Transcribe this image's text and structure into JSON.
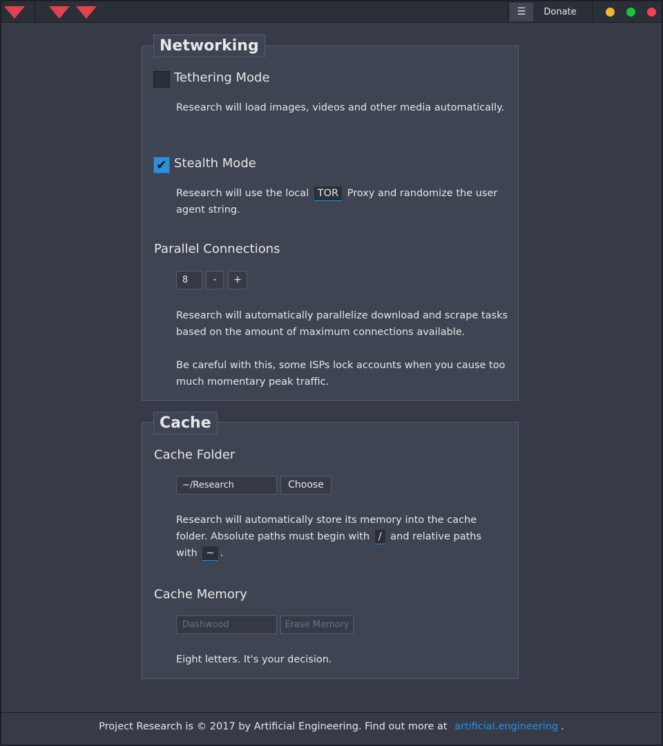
{
  "titlebar": {
    "menu_icon": "☰",
    "donate_label": "Donate",
    "colors": {
      "accent_triangle": "#e0434c",
      "minimize": "#f2b43d",
      "maximize": "#19c33b",
      "close": "#f0444f"
    }
  },
  "networking": {
    "legend": "Networking",
    "tethering": {
      "label": "Tethering Mode",
      "checked": false,
      "description": "Research will load images, videos and other media automatically."
    },
    "stealth": {
      "label": "Stealth Mode",
      "checked": true,
      "check_glyph": "✔",
      "desc_before": "Research will use the local",
      "desc_code": "TOR",
      "desc_after": "Proxy and randomize the user agent string."
    },
    "parallel": {
      "label": "Parallel Connections",
      "value": "8",
      "minus": "-",
      "plus": "+",
      "description_1": "Research will automatically parallelize download and scrape tasks based on the amount of maximum connections available.",
      "description_2": "Be careful with this, some ISPs lock accounts when you cause too much momentary peak traffic."
    }
  },
  "cache": {
    "legend": "Cache",
    "folder": {
      "label": "Cache Folder",
      "value": "~/Research",
      "button": "Choose",
      "desc_1": "Research will automatically store its memory into the cache folder. Absolute paths must begin with",
      "desc_code_1": "/",
      "desc_2": "and relative paths with",
      "desc_code_2": "~",
      "desc_3": "."
    },
    "memory": {
      "label": "Cache Memory",
      "placeholder": "Dashwood",
      "button": "Erase Memory",
      "description": "Eight letters. It's your decision."
    }
  },
  "footer": {
    "text": "Project Research is © 2017 by Artificial Engineering. Find out more at",
    "link": "artificial.engineering",
    "end": "."
  }
}
